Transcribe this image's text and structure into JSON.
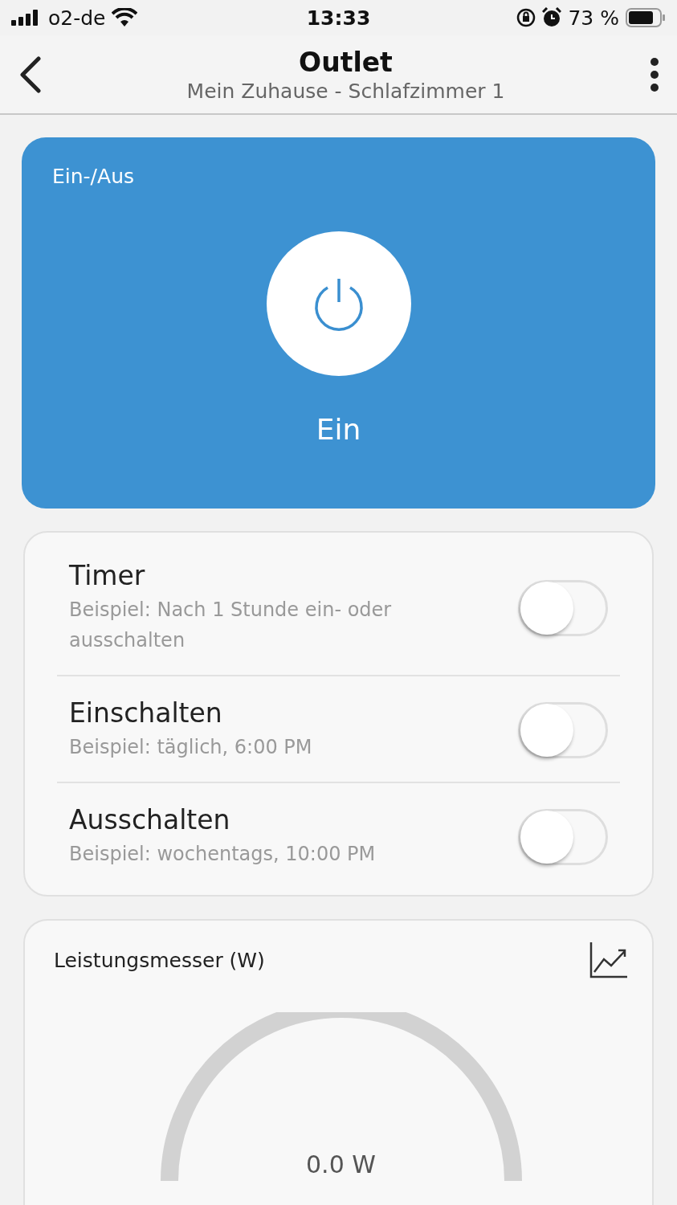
{
  "status_bar": {
    "carrier": "o2-de",
    "time": "13:33",
    "battery": "73 %"
  },
  "header": {
    "title": "Outlet",
    "subtitle": "Mein Zuhause - Schlafzimmer 1"
  },
  "power_card": {
    "label": "Ein-/Aus",
    "state": "Ein",
    "on": true
  },
  "schedules": [
    {
      "title": "Timer",
      "description": "Beispiel: Nach 1 Stunde ein- oder ausschalten",
      "on": false
    },
    {
      "title": "Einschalten",
      "description": "Beispiel: täglich, 6:00 PM",
      "on": false
    },
    {
      "title": "Ausschalten",
      "description": "Beispiel: wochentags, 10:00 PM",
      "on": false
    }
  ],
  "power_meter": {
    "title": "Leistungsmesser (W)",
    "reading": "0.0 W"
  }
}
